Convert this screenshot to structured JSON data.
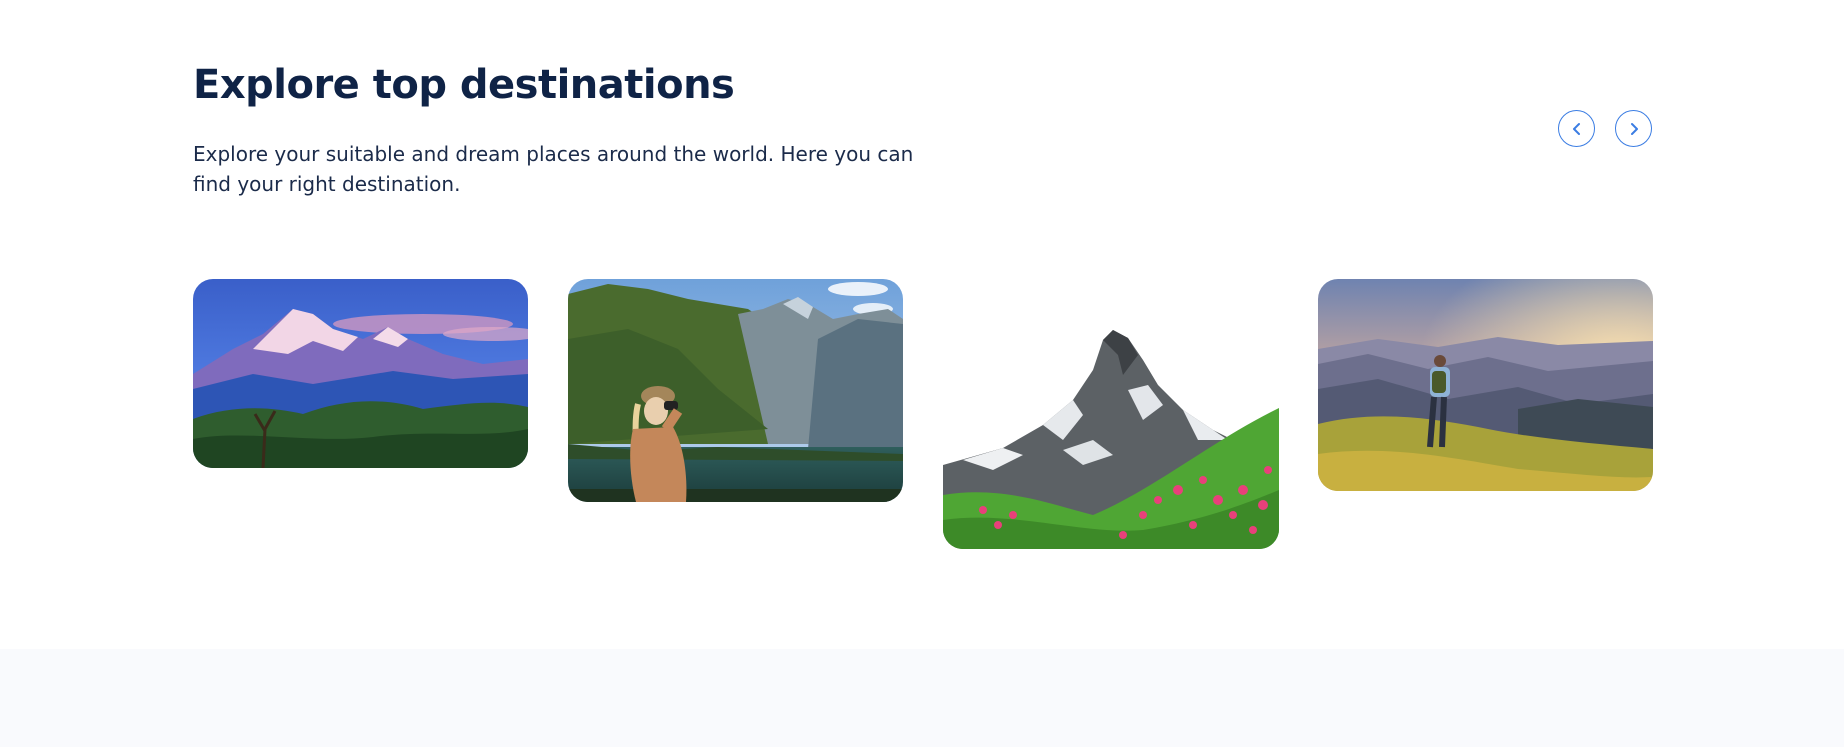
{
  "section": {
    "title": "Explore top destinations",
    "description": "Explore your suitable and dream places around the world. Here you can find your right destination."
  },
  "carousel": {
    "prev_icon": "chevron-left-icon",
    "next_icon": "chevron-right-icon",
    "accent_color": "#3b7de3"
  },
  "destinations": [
    {
      "image": "snow-mountain-sunset"
    },
    {
      "image": "hiker-binoculars-lake"
    },
    {
      "image": "matterhorn-flowers"
    },
    {
      "image": "hiker-mountain-sunrise"
    }
  ],
  "colors": {
    "heading": "#0f2346",
    "body_text": "#1b2b4a",
    "footer_band": "#f9fafd"
  }
}
